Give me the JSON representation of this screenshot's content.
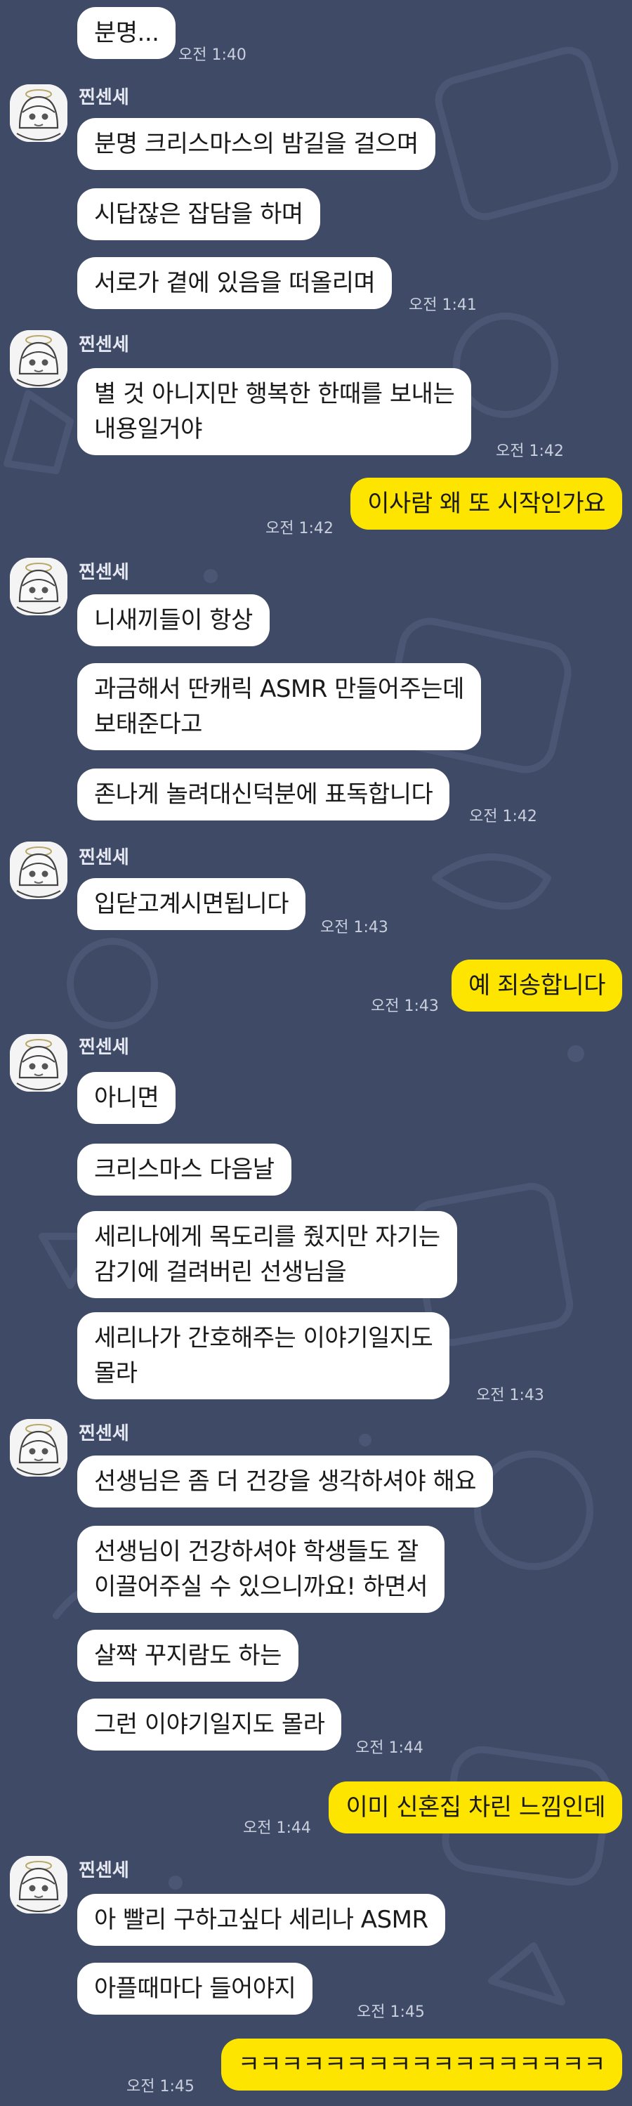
{
  "sender_name": "찐센세",
  "colors": {
    "background": "#3f4a66",
    "bubble_other": "#ffffff",
    "bubble_mine": "#fee500",
    "timestamp": "#c9cfdc"
  },
  "messages": [
    {
      "text": "분명...",
      "time": "오전 1:40"
    },
    {
      "text": "분명 크리스마스의 밤길을 걸으며"
    },
    {
      "text": "시답잖은 잡담을 하며"
    },
    {
      "text": "서로가 곁에 있음을 떠올리며",
      "time": "오전 1:41"
    },
    {
      "text": "별 것 아니지만 행복한 한때를 보내는\n내용일거야",
      "time": "오전 1:42"
    },
    {
      "text": "이사람 왜 또 시작인가요",
      "time": "오전 1:42"
    },
    {
      "text": "니새끼들이 항상"
    },
    {
      "text": "과금해서 딴캐릭 ASMR 만들어주는데\n보태준다고"
    },
    {
      "text": "존나게 놀려대신덕분에 표독합니다",
      "time": "오전 1:42"
    },
    {
      "text": "입닫고계시면됩니다",
      "time": "오전 1:43"
    },
    {
      "text": "예 죄송합니다",
      "time": "오전 1:43"
    },
    {
      "text": "아니면"
    },
    {
      "text": "크리스마스 다음날"
    },
    {
      "text": "세리나에게 목도리를 줬지만 자기는\n감기에 걸려버린 선생님을"
    },
    {
      "text": "세리나가 간호해주는 이야기일지도\n몰라",
      "time": "오전 1:43"
    },
    {
      "text": "선생님은 좀 더 건강을 생각하셔야 해요"
    },
    {
      "text": "선생님이 건강하셔야 학생들도 잘\n이끌어주실 수 있으니까요! 하면서"
    },
    {
      "text": "살짝 꾸지람도 하는"
    },
    {
      "text": "그런 이야기일지도 몰라",
      "time": "오전 1:44"
    },
    {
      "text": "이미 신혼집 차린 느낌인데",
      "time": "오전 1:44"
    },
    {
      "text": "아 빨리 구하고싶다 세리나 ASMR"
    },
    {
      "text": "아플때마다 들어야지",
      "time": "오전 1:45"
    },
    {
      "text": "ㅋㅋㅋㅋㅋㅋㅋㅋㅋㅋㅋㅋㅋㅋㅋㅋㅋ",
      "time": "오전 1:45"
    }
  ]
}
